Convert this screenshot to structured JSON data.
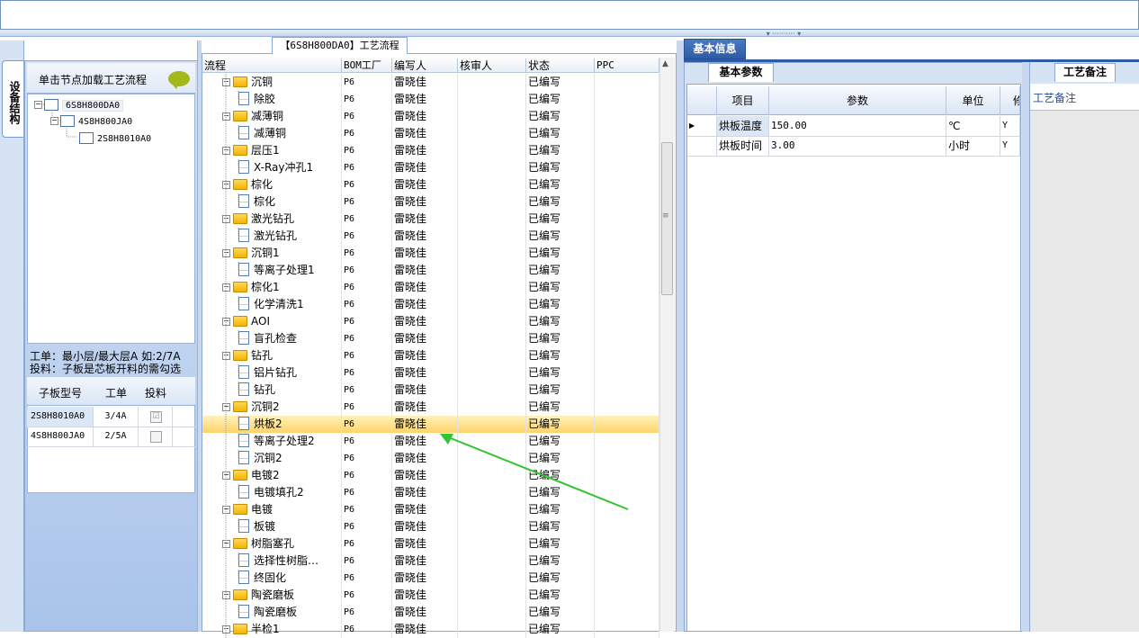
{
  "colors": {
    "accent_blue": "#2e5ba6",
    "selection": "#ffd36a",
    "arrow": "#33c433"
  },
  "left_tab": {
    "label": "设备结构"
  },
  "structure": {
    "header": "单击节点加载工艺流程",
    "tree": [
      {
        "label": "6S8H800DA0"
      },
      {
        "label": "4S8H800JA0"
      },
      {
        "label": "2S8H8010A0"
      }
    ],
    "info_line1": "工单：最小层/最大层A 如:2/7A",
    "info_line2": "投料：子板是芯板开料的需勾选",
    "sub_columns": [
      "子板型号",
      "工单",
      "投料"
    ],
    "sub_rows": [
      {
        "model": "2S8H8010A0",
        "order": "3/4A",
        "feed": "☑"
      },
      {
        "model": "4S8H800JA0",
        "order": "2/5A",
        "feed": ""
      }
    ]
  },
  "process": {
    "tab_label": "【6S8H800DA0】工艺流程",
    "columns": [
      "流程",
      "BOM工厂",
      "编写人",
      "核审人",
      "状态",
      "PPC"
    ],
    "rows": [
      {
        "type": "folder",
        "name": "沉铜",
        "bom": "P6",
        "writer": "雷晓佳",
        "status": "已编写"
      },
      {
        "type": "doc",
        "name": "除胶",
        "bom": "P6",
        "writer": "雷晓佳",
        "status": "已编写"
      },
      {
        "type": "folder",
        "name": "减薄铜",
        "bom": "P6",
        "writer": "雷晓佳",
        "status": "已编写"
      },
      {
        "type": "doc",
        "name": "减薄铜",
        "bom": "P6",
        "writer": "雷晓佳",
        "status": "已编写"
      },
      {
        "type": "folder",
        "name": "层压1",
        "bom": "P6",
        "writer": "雷晓佳",
        "status": "已编写"
      },
      {
        "type": "doc",
        "name": "X-Ray冲孔1",
        "bom": "P6",
        "writer": "雷晓佳",
        "status": "已编写"
      },
      {
        "type": "folder",
        "name": "棕化",
        "bom": "P6",
        "writer": "雷晓佳",
        "status": "已编写"
      },
      {
        "type": "doc",
        "name": "棕化",
        "bom": "P6",
        "writer": "雷晓佳",
        "status": "已编写"
      },
      {
        "type": "folder",
        "name": "激光钻孔",
        "bom": "P6",
        "writer": "雷晓佳",
        "status": "已编写"
      },
      {
        "type": "doc",
        "name": "激光钻孔",
        "bom": "P6",
        "writer": "雷晓佳",
        "status": "已编写"
      },
      {
        "type": "folder",
        "name": "沉铜1",
        "bom": "P6",
        "writer": "雷晓佳",
        "status": "已编写"
      },
      {
        "type": "doc",
        "name": "等离子处理1",
        "bom": "P6",
        "writer": "雷晓佳",
        "status": "已编写"
      },
      {
        "type": "folder",
        "name": "棕化1",
        "bom": "P6",
        "writer": "雷晓佳",
        "status": "已编写"
      },
      {
        "type": "doc",
        "name": "化学清洗1",
        "bom": "P6",
        "writer": "雷晓佳",
        "status": "已编写"
      },
      {
        "type": "folder",
        "name": "AOI",
        "bom": "P6",
        "writer": "雷晓佳",
        "status": "已编写"
      },
      {
        "type": "doc",
        "name": "盲孔检查",
        "bom": "P6",
        "writer": "雷晓佳",
        "status": "已编写"
      },
      {
        "type": "folder",
        "name": "钻孔",
        "bom": "P6",
        "writer": "雷晓佳",
        "status": "已编写"
      },
      {
        "type": "doc",
        "name": "铝片钻孔",
        "bom": "P6",
        "writer": "雷晓佳",
        "status": "已编写"
      },
      {
        "type": "doc",
        "name": "钻孔",
        "bom": "P6",
        "writer": "雷晓佳",
        "status": "已编写"
      },
      {
        "type": "folder",
        "name": "沉铜2",
        "bom": "P6",
        "writer": "雷晓佳",
        "status": "已编写"
      },
      {
        "type": "doc",
        "name": "烘板2",
        "bom": "P6",
        "writer": "雷晓佳",
        "status": "已编写",
        "selected": true
      },
      {
        "type": "doc",
        "name": "等离子处理2",
        "bom": "P6",
        "writer": "雷晓佳",
        "status": "已编写"
      },
      {
        "type": "doc",
        "name": "沉铜2",
        "bom": "P6",
        "writer": "雷晓佳",
        "status": "已编写"
      },
      {
        "type": "folder",
        "name": "电镀2",
        "bom": "P6",
        "writer": "雷晓佳",
        "status": "已编写"
      },
      {
        "type": "doc",
        "name": "电镀填孔2",
        "bom": "P6",
        "writer": "雷晓佳",
        "status": "已编写"
      },
      {
        "type": "folder",
        "name": "电镀",
        "bom": "P6",
        "writer": "雷晓佳",
        "status": "已编写"
      },
      {
        "type": "doc",
        "name": "板镀",
        "bom": "P6",
        "writer": "雷晓佳",
        "status": "已编写"
      },
      {
        "type": "folder",
        "name": "树脂塞孔",
        "bom": "P6",
        "writer": "雷晓佳",
        "status": "已编写"
      },
      {
        "type": "doc",
        "name": "选择性树脂…",
        "bom": "P6",
        "writer": "雷晓佳",
        "status": "已编写"
      },
      {
        "type": "doc",
        "name": "终固化",
        "bom": "P6",
        "writer": "雷晓佳",
        "status": "已编写"
      },
      {
        "type": "folder",
        "name": "陶瓷磨板",
        "bom": "P6",
        "writer": "雷晓佳",
        "status": "已编写"
      },
      {
        "type": "doc",
        "name": "陶瓷磨板",
        "bom": "P6",
        "writer": "雷晓佳",
        "status": "已编写"
      },
      {
        "type": "folder",
        "name": "半检1",
        "bom": "P6",
        "writer": "雷晓佳",
        "status": "已编写"
      }
    ]
  },
  "basic_info": {
    "tab_label": "基本信息",
    "params_tab": "基本参数",
    "columns": [
      "项目",
      "参数",
      "单位",
      "修"
    ],
    "rows": [
      {
        "item": "烘板温度",
        "value": "150.00",
        "unit": "℃",
        "flag": "Y"
      },
      {
        "item": "烘板时间",
        "value": "3.00",
        "unit": "小时",
        "flag": "Y"
      }
    ]
  },
  "notes": {
    "tab_label": "工艺备注",
    "field_label": "工艺备注"
  }
}
